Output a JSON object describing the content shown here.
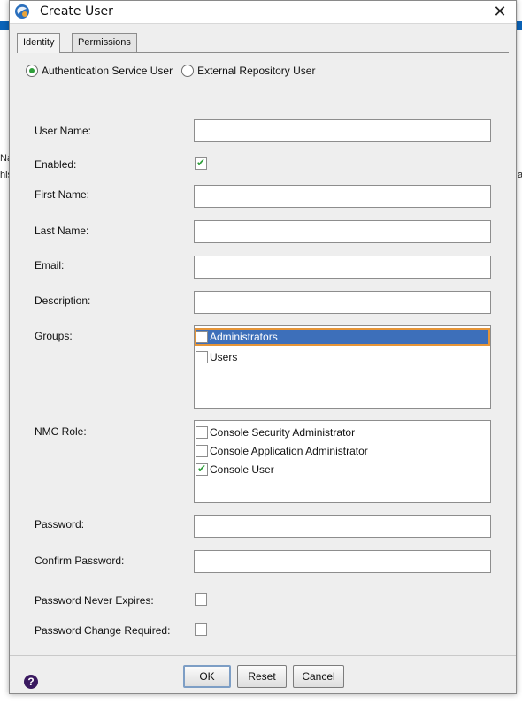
{
  "dialog": {
    "title": "Create User",
    "close_glyph": "✕"
  },
  "tabs": [
    {
      "label": "Identity"
    },
    {
      "label": "Permissions"
    }
  ],
  "user_type": {
    "options": [
      {
        "label": "Authentication Service User",
        "selected": true
      },
      {
        "label": "External Repository User",
        "selected": false
      }
    ]
  },
  "form": {
    "user_name_label": "User Name:",
    "enabled_label": "Enabled:",
    "enabled": true,
    "first_name_label": "First Name:",
    "last_name_label": "Last Name:",
    "email_label": "Email:",
    "description_label": "Description:",
    "groups_label": "Groups:",
    "groups": [
      {
        "label": "Administrators",
        "checked": false,
        "selected": true
      },
      {
        "label": "Users",
        "checked": false,
        "selected": false
      }
    ],
    "nmc_role_label": "NMC Role:",
    "nmc_roles": [
      {
        "label": "Console Security Administrator",
        "checked": false
      },
      {
        "label": "Console Application Administrator",
        "checked": false
      },
      {
        "label": "Console User",
        "checked": true
      }
    ],
    "password_label": "Password:",
    "confirm_password_label": "Confirm Password:",
    "password_never_expires_label": "Password Never Expires:",
    "password_never_expires": false,
    "password_change_required_label": "Password Change Required:",
    "password_change_required": false,
    "values": {
      "user_name": "",
      "first_name": "",
      "last_name": "",
      "email": "",
      "description": "",
      "password": "",
      "confirm_password": ""
    }
  },
  "buttons": {
    "ok": "OK",
    "reset": "Reset",
    "cancel": "Cancel",
    "help_glyph": "?"
  },
  "background": {
    "fragments": [
      "Na",
      "his",
      "a"
    ]
  },
  "colors": {
    "accent": "#3d6fba",
    "check": "#2e9e3a",
    "focus": "#e69538"
  }
}
